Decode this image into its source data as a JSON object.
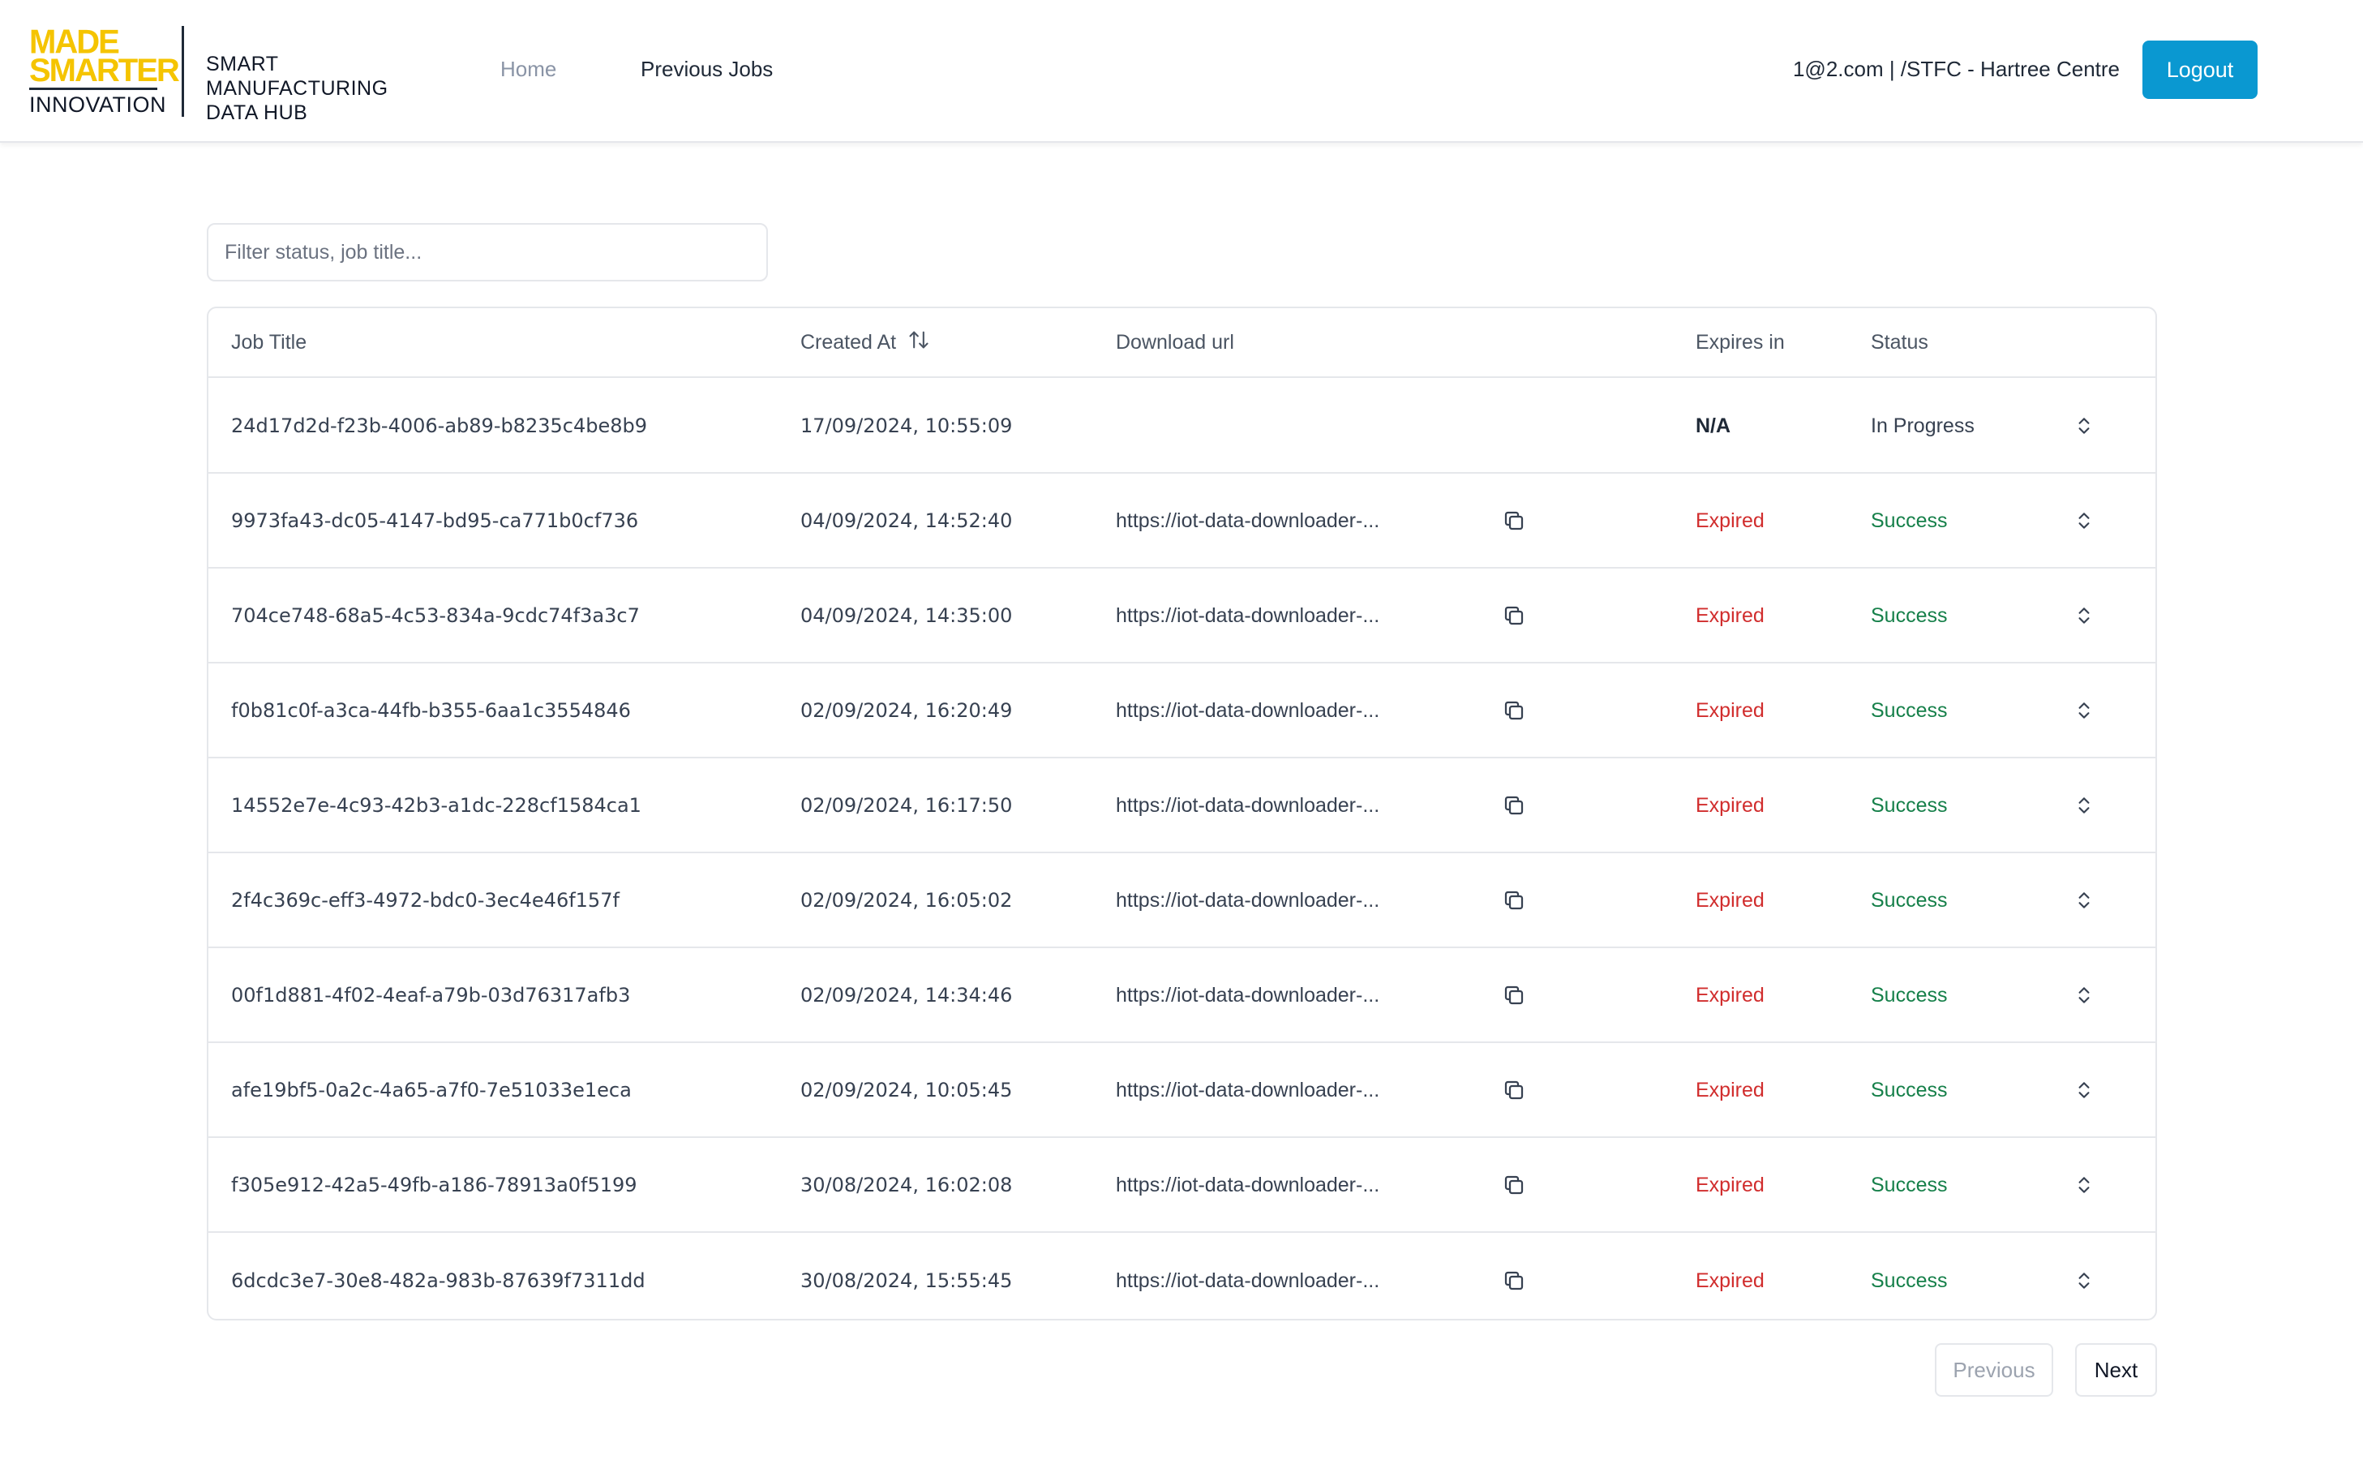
{
  "brand": {
    "line1": "MADE",
    "line2": "SMARTER",
    "line3": "INNOVATION",
    "hub": [
      "SMART",
      "MANUFACTURING",
      "DATA HUB"
    ],
    "accent_color": "#f5c400"
  },
  "nav": {
    "home": "Home",
    "previous_jobs": "Previous Jobs"
  },
  "user": {
    "info": "1@2.com | /STFC - Hartree Centre",
    "logout": "Logout",
    "logout_color": "#0a98d1"
  },
  "filter": {
    "placeholder": "Filter status, job title..."
  },
  "table": {
    "headers": {
      "job_title": "Job Title",
      "created_at": "Created At",
      "download_url": "Download url",
      "expires_in": "Expires in",
      "status": "Status"
    },
    "rows": [
      {
        "title": "24d17d2d-f23b-4006-ab89-b8235c4be8b9",
        "created": "17/09/2024, 10:55:09",
        "url": "",
        "expires": "N/A",
        "status": "In Progress"
      },
      {
        "title": "9973fa43-dc05-4147-bd95-ca771b0cf736",
        "created": "04/09/2024, 14:52:40",
        "url": "https://iot-data-downloader-...",
        "expires": "Expired",
        "status": "Success"
      },
      {
        "title": "704ce748-68a5-4c53-834a-9cdc74f3a3c7",
        "created": "04/09/2024, 14:35:00",
        "url": "https://iot-data-downloader-...",
        "expires": "Expired",
        "status": "Success"
      },
      {
        "title": "f0b81c0f-a3ca-44fb-b355-6aa1c3554846",
        "created": "02/09/2024, 16:20:49",
        "url": "https://iot-data-downloader-...",
        "expires": "Expired",
        "status": "Success"
      },
      {
        "title": "14552e7e-4c93-42b3-a1dc-228cf1584ca1",
        "created": "02/09/2024, 16:17:50",
        "url": "https://iot-data-downloader-...",
        "expires": "Expired",
        "status": "Success"
      },
      {
        "title": "2f4c369c-eff3-4972-bdc0-3ec4e46f157f",
        "created": "02/09/2024, 16:05:02",
        "url": "https://iot-data-downloader-...",
        "expires": "Expired",
        "status": "Success"
      },
      {
        "title": "00f1d881-4f02-4eaf-a79b-03d76317afb3",
        "created": "02/09/2024, 14:34:46",
        "url": "https://iot-data-downloader-...",
        "expires": "Expired",
        "status": "Success"
      },
      {
        "title": "afe19bf5-0a2c-4a65-a7f0-7e51033e1eca",
        "created": "02/09/2024, 10:05:45",
        "url": "https://iot-data-downloader-...",
        "expires": "Expired",
        "status": "Success"
      },
      {
        "title": "f305e912-42a5-49fb-a186-78913a0f5199",
        "created": "30/08/2024, 16:02:08",
        "url": "https://iot-data-downloader-...",
        "expires": "Expired",
        "status": "Success"
      },
      {
        "title": "6dcdc3e7-30e8-482a-983b-87639f7311dd",
        "created": "30/08/2024, 15:55:45",
        "url": "https://iot-data-downloader-...",
        "expires": "Expired",
        "status": "Success"
      }
    ]
  },
  "pagination": {
    "previous": "Previous",
    "next": "Next"
  },
  "colors": {
    "expired": "#d12d2d",
    "success": "#16804a"
  }
}
